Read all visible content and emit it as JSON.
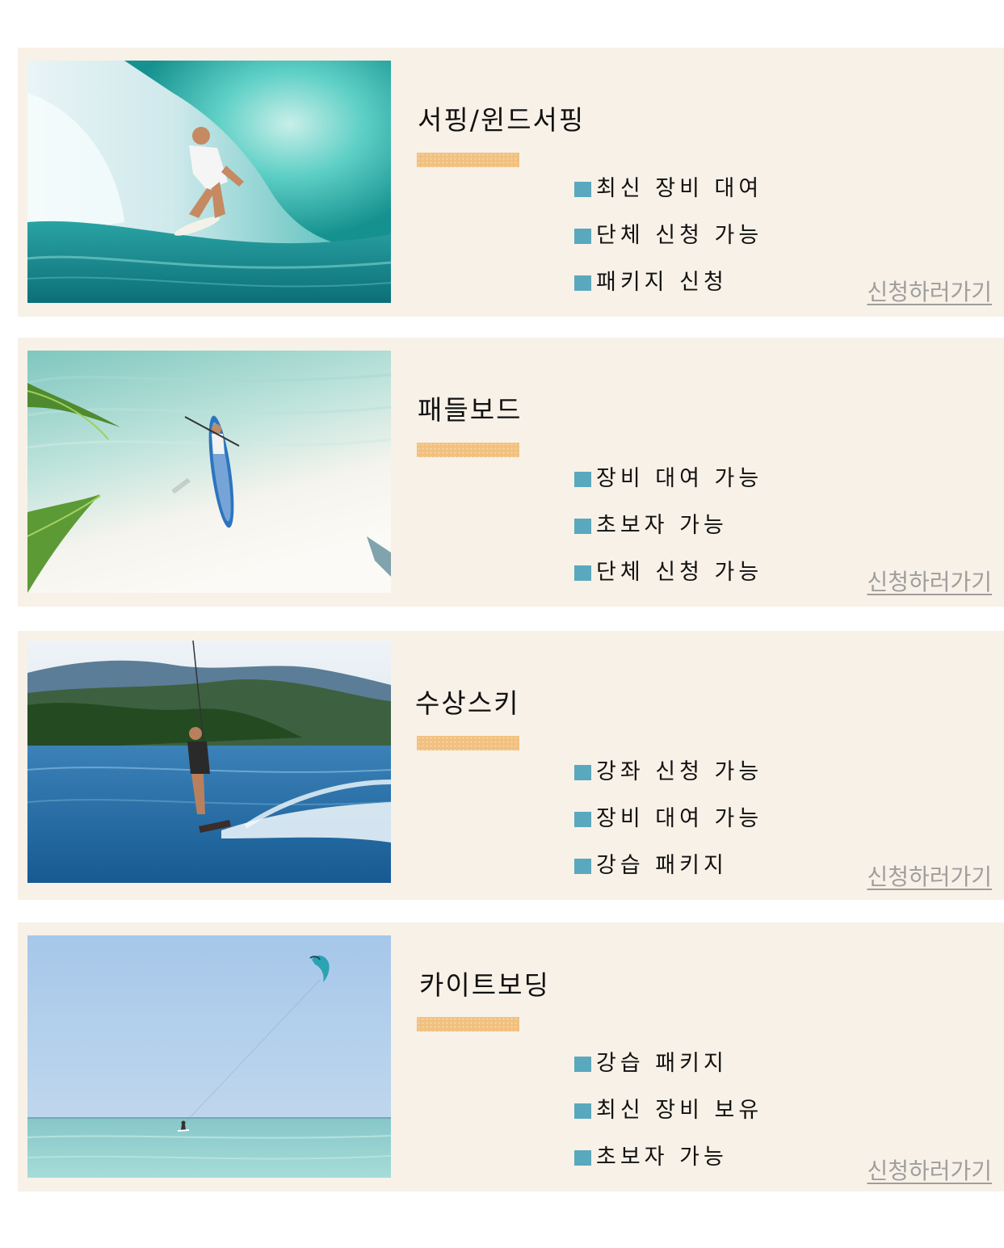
{
  "activities": [
    {
      "title": "서핑/윈드서핑",
      "image_alt": "surfer-in-wave",
      "features": [
        "최신 장비 대여",
        "단체 신청 가능",
        "패키지 신청"
      ],
      "link_label": "신청하러가기"
    },
    {
      "title": "패들보드",
      "image_alt": "paddleboard-aerial",
      "features": [
        "장비 대여 가능",
        "초보자 가능",
        "단체 신청 가능"
      ],
      "link_label": "신청하러가기"
    },
    {
      "title": "수상스키",
      "image_alt": "wakeboarder-on-lake",
      "features": [
        "강좌 신청 가능",
        "장비 대여 가능",
        "강습 패키지"
      ],
      "link_label": "신청하러가기"
    },
    {
      "title": "카이트보딩",
      "image_alt": "kiteboarder-at-sea",
      "features": [
        "강습 패키지",
        "최신 장비 보유",
        "초보자 가능"
      ],
      "link_label": "신청하러가기"
    }
  ],
  "colors": {
    "card_background": "#f8f1e7",
    "title_bar": "#f2c07e",
    "bullet": "#5aa8bd",
    "link": "#9e9e9e"
  }
}
